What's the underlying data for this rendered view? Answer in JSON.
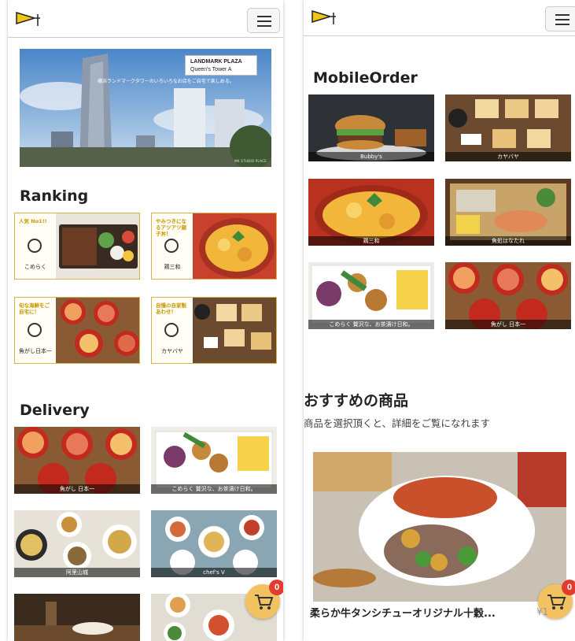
{
  "left": {
    "header": {
      "logo": "flag-logo",
      "menu": "hamburger-menu"
    },
    "hero": {
      "badge_line1": "LANDMARK PLAZA",
      "badge_line2": "Queen's Tower A",
      "caption": "横浜ランドマークタワーのいろいろなお店をご自宅で楽しめる。",
      "credit": "MK STUDIO PLACE"
    },
    "ranking": {
      "title": "Ranking",
      "cards": [
        {
          "tag": "人気 No1!!",
          "shop": "こめらく"
        },
        {
          "tag": "やみつきになるアツアツ親子丼！",
          "shop": "鶏三和"
        },
        {
          "tag": "旬な海鮮をご自宅に！",
          "shop": "魚がし日本一"
        },
        {
          "tag": "自慢の自家製あわせ！",
          "shop": "カヤバヤ"
        }
      ]
    },
    "delivery": {
      "title": "Delivery",
      "tiles": [
        "魚がし 日本一",
        "こめらく 贅沢な、お茶漬け日和。",
        "阿里山城",
        "chef's V",
        "",
        ""
      ]
    },
    "cart_count": "0"
  },
  "right": {
    "mobile_order": {
      "title": "MobileOrder",
      "tiles": [
        "Bubby's",
        "カヤバヤ",
        "鶏三和",
        "魚処はなたれ",
        "こめらく 贅沢な、お茶漬け日和。",
        "魚がし 日本一"
      ]
    },
    "recommend": {
      "title": "おすすめの商品",
      "subtitle": "商品を選択頂くと、詳細をご覧になれます",
      "product_name": "柔らか牛タンシチューオリジナル十穀...",
      "product_price": "¥1"
    },
    "cart_count": "0"
  },
  "colors": {
    "accent": "#f2c261",
    "badge": "#e23c2f",
    "rank_border": "#d8b34a"
  }
}
